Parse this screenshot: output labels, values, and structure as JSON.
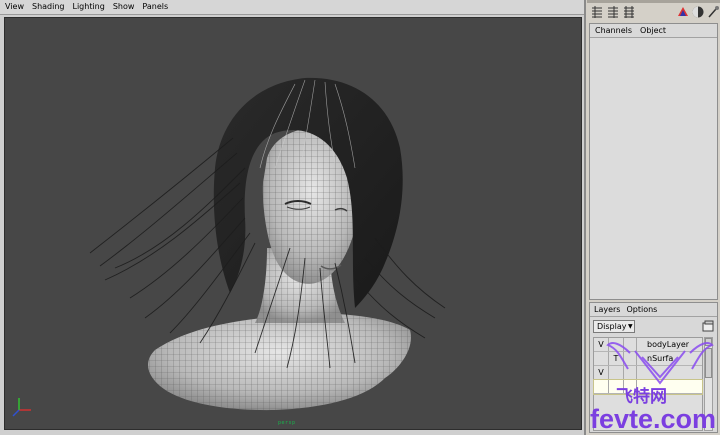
{
  "viewport_menu": [
    "View",
    "Shading",
    "Lighting",
    "Show",
    "Panels"
  ],
  "viewport": {
    "camera_label": "persp",
    "background": "#474747",
    "axis_labels": {
      "x": "x",
      "y": "y",
      "z": "z"
    }
  },
  "toolbar_icons": [
    "channel-box-toggle-icon",
    "attribute-editor-toggle-icon",
    "tool-settings-toggle-icon",
    "render-icon",
    "shading-ball-icon",
    "pick-tool-icon"
  ],
  "channel_box": {
    "tabs": [
      "Channels",
      "Object"
    ]
  },
  "layer_editor": {
    "tabs": [
      "Layers",
      "Options"
    ],
    "display_select": "Display",
    "layers": [
      {
        "visible": "V",
        "type": "",
        "name": "bodyLayer"
      },
      {
        "visible": "",
        "type": "T",
        "name": "nSurfa"
      },
      {
        "visible": "V",
        "type": "",
        "name": ""
      },
      {
        "visible": "",
        "type": "",
        "name": ""
      }
    ]
  },
  "watermark": {
    "text": "fevte.com",
    "chinese": "飞特网",
    "color": "#7b3fe0"
  }
}
